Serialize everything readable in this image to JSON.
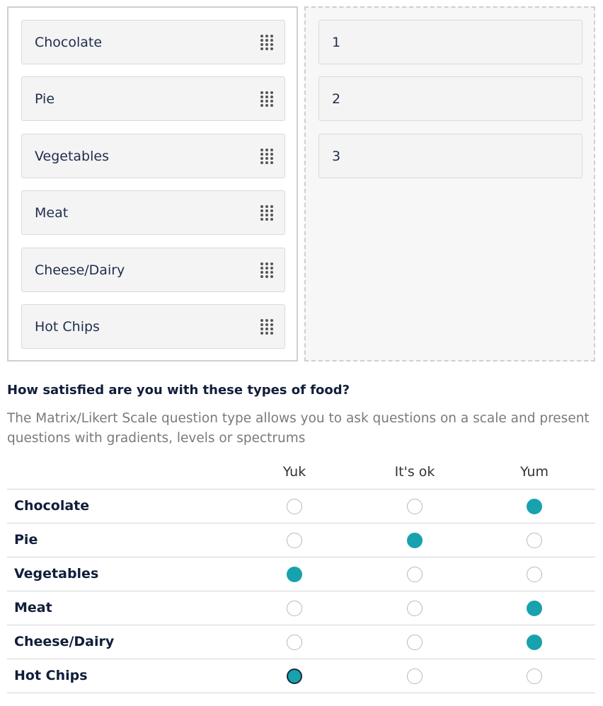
{
  "ranking": {
    "items": [
      "Chocolate",
      "Pie",
      "Vegetables",
      "Meat",
      "Cheese/Dairy",
      "Hot Chips"
    ],
    "slots": [
      "1",
      "2",
      "3"
    ]
  },
  "question": {
    "title": "How satisfied are you with these types of food?",
    "description": "The Matrix/Likert Scale question type allows you to ask questions on a scale and present questions with gradients, levels or spectrums"
  },
  "matrix": {
    "columns": [
      "Yuk",
      "It's ok",
      "Yum"
    ],
    "rows": [
      {
        "label": "Chocolate",
        "selected": "Yum"
      },
      {
        "label": "Pie",
        "selected": "It's ok"
      },
      {
        "label": "Vegetables",
        "selected": "Yuk"
      },
      {
        "label": "Meat",
        "selected": "Yum"
      },
      {
        "label": "Cheese/Dairy",
        "selected": "Yum"
      },
      {
        "label": "Hot Chips",
        "selected": "Yuk",
        "focused": true
      }
    ],
    "accent_color": "#17a2ad"
  }
}
